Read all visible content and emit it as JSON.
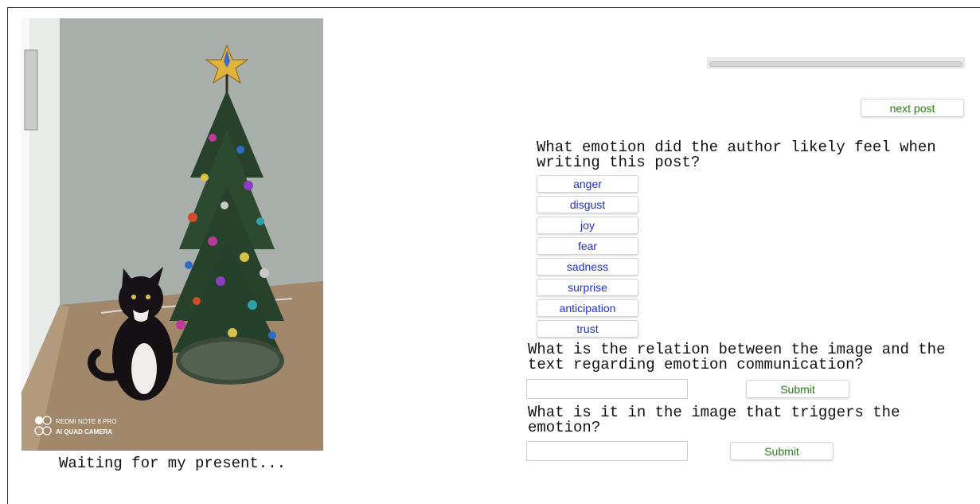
{
  "post": {
    "caption": "Waiting for my present...",
    "watermark_line1": "REDMI NOTE 8 PRO",
    "watermark_line2": "AI QUAD CAMERA"
  },
  "nav": {
    "next_label": "next post"
  },
  "q1": {
    "text": "What emotion did the author likely feel when writing this post?",
    "options": [
      "anger",
      "disgust",
      "joy",
      "fear",
      "sadness",
      "surprise",
      "anticipation",
      "trust"
    ]
  },
  "q2": {
    "text": "What is the relation between the image and the text regarding emotion communication?",
    "input_value": "",
    "submit_label": "Submit"
  },
  "q3": {
    "text": "What is it in the image that triggers the emotion?",
    "input_value": "",
    "submit_label": "Submit"
  },
  "colors": {
    "option_text": "#1d2fd0",
    "submit_text": "#2a7d12",
    "tree": "#27412b",
    "star": "#e0b33a"
  }
}
